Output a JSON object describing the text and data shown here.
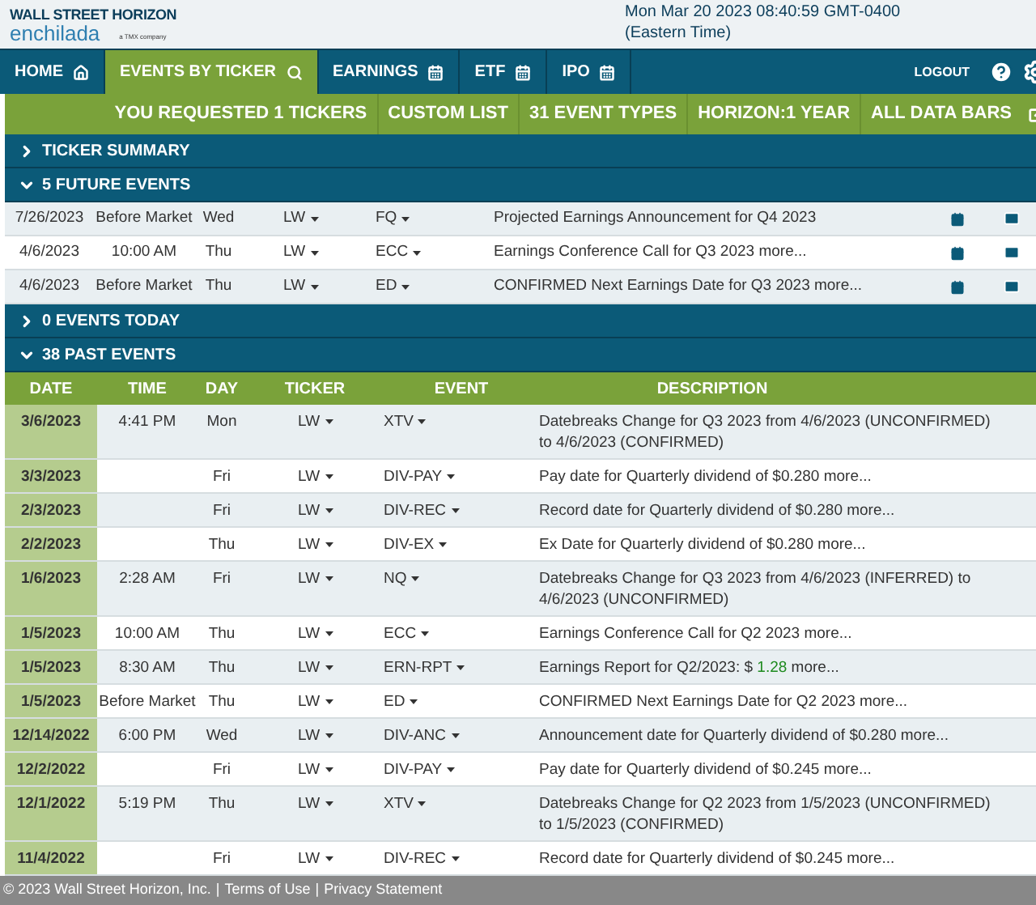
{
  "header": {
    "logo_top": "WALL STREET HORIZON",
    "logo_bottom": "enchilada",
    "logo_tag": "a TMX company",
    "datetime": "Mon Mar 20 2023 08:40:59 GMT-0400",
    "timezone": "(Eastern Time)"
  },
  "nav": {
    "tabs": [
      {
        "label": "HOME",
        "selected": false
      },
      {
        "label": "EVENTS BY TICKER",
        "selected": true
      },
      {
        "label": "EARNINGS",
        "selected": false
      },
      {
        "label": "ETF",
        "selected": false
      },
      {
        "label": "IPO",
        "selected": false
      }
    ],
    "logout": "LOGOUT"
  },
  "subnav": [
    "YOU REQUESTED 1 TICKERS",
    "CUSTOM LIST",
    "31 EVENT TYPES",
    "HORIZON:1 YEAR",
    "ALL DATA BARS"
  ],
  "sections": [
    {
      "title": "TICKER SUMMARY",
      "expanded": false
    },
    {
      "title": "5 FUTURE EVENTS",
      "expanded": true
    }
  ],
  "future_events": [
    {
      "date": "7/26/2023",
      "time": "Before Market",
      "day": "Wed",
      "ticker": "LW",
      "event": "FQ",
      "description": "Projected Earnings Announcement for Q4 2023"
    },
    {
      "date": "4/6/2023",
      "time": "10:00 AM",
      "day": "Thu",
      "ticker": "LW",
      "event": "ECC",
      "description": "Earnings Conference Call for Q3 2023 more..."
    },
    {
      "date": "4/6/2023",
      "time": "Before Market",
      "day": "Thu",
      "ticker": "LW",
      "event": "ED",
      "description": "CONFIRMED Next Earnings Date for Q3 2023 more..."
    }
  ],
  "sections_2": [
    {
      "title": "0 EVENTS TODAY",
      "expanded": false
    },
    {
      "title": "38 PAST EVENTS",
      "expanded": true
    }
  ],
  "past_columns": [
    "DATE",
    "TIME",
    "DAY",
    "TICKER",
    "EVENT",
    "DESCRIPTION"
  ],
  "past_events": [
    {
      "date": "3/6/2023",
      "time": "4:41 PM",
      "day": "Mon",
      "ticker": "LW",
      "event": "XTV",
      "description": "Datebreaks Change for Q3 2023 from 4/6/2023 (UNCONFIRMED) to 4/6/2023 (CONFIRMED)"
    },
    {
      "date": "3/3/2023",
      "day": "Fri",
      "ticker": "LW",
      "event": "DIV-PAY",
      "description": "Pay date for Quarterly dividend of $0.280 more..."
    },
    {
      "date": "2/3/2023",
      "day": "Fri",
      "ticker": "LW",
      "event": "DIV-REC",
      "description": "Record date for Quarterly dividend of $0.280 more..."
    },
    {
      "date": "2/2/2023",
      "day": "Thu",
      "ticker": "LW",
      "event": "DIV-EX",
      "description": "Ex Date for Quarterly dividend of $0.280 more..."
    },
    {
      "date": "1/6/2023",
      "time": "2:28 AM",
      "day": "Fri",
      "ticker": "LW",
      "event": "NQ",
      "description": "Datebreaks Change for Q3 2023 from 4/6/2023 (INFERRED) to 4/6/2023 (UNCONFIRMED)"
    },
    {
      "date": "1/5/2023",
      "time": "10:00 AM",
      "day": "Thu",
      "ticker": "LW",
      "event": "ECC",
      "description": "Earnings Conference Call for Q2 2023 more..."
    },
    {
      "date": "1/5/2023",
      "time": "8:30 AM",
      "day": "Thu",
      "ticker": "LW",
      "event": "ERN-RPT",
      "description": "Earnings Report for Q2/2023: $",
      "value": "1.28",
      "suffix": "more..."
    },
    {
      "date": "1/5/2023",
      "time": "Before Market",
      "day": "Thu",
      "ticker": "LW",
      "event": "ED",
      "description": "CONFIRMED Next Earnings Date for Q2 2023 more..."
    },
    {
      "date": "12/14/2022",
      "time": "6:00 PM",
      "day": "Wed",
      "ticker": "LW",
      "event": "DIV-ANC",
      "description": "Announcement date for Quarterly dividend of $0.280 more..."
    },
    {
      "date": "12/2/2022",
      "day": "Fri",
      "ticker": "LW",
      "event": "DIV-PAY",
      "description": "Pay date for Quarterly dividend of $0.245 more..."
    },
    {
      "date": "12/1/2022",
      "time": "5:19 PM",
      "day": "Thu",
      "ticker": "LW",
      "event": "XTV",
      "description": "Datebreaks Change for Q2 2023 from 1/5/2023 (UNCONFIRMED) to 1/5/2023 (CONFIRMED)"
    },
    {
      "date": "11/4/2022",
      "day": "Fri",
      "ticker": "LW",
      "event": "DIV-REC",
      "description": "Record date for Quarterly dividend of $0.245 more..."
    }
  ],
  "footer": {
    "items": [
      "© 2023 Wall Street Horizon, Inc.",
      "Terms of Use",
      "Privacy Statement"
    ],
    "separator": "|"
  }
}
